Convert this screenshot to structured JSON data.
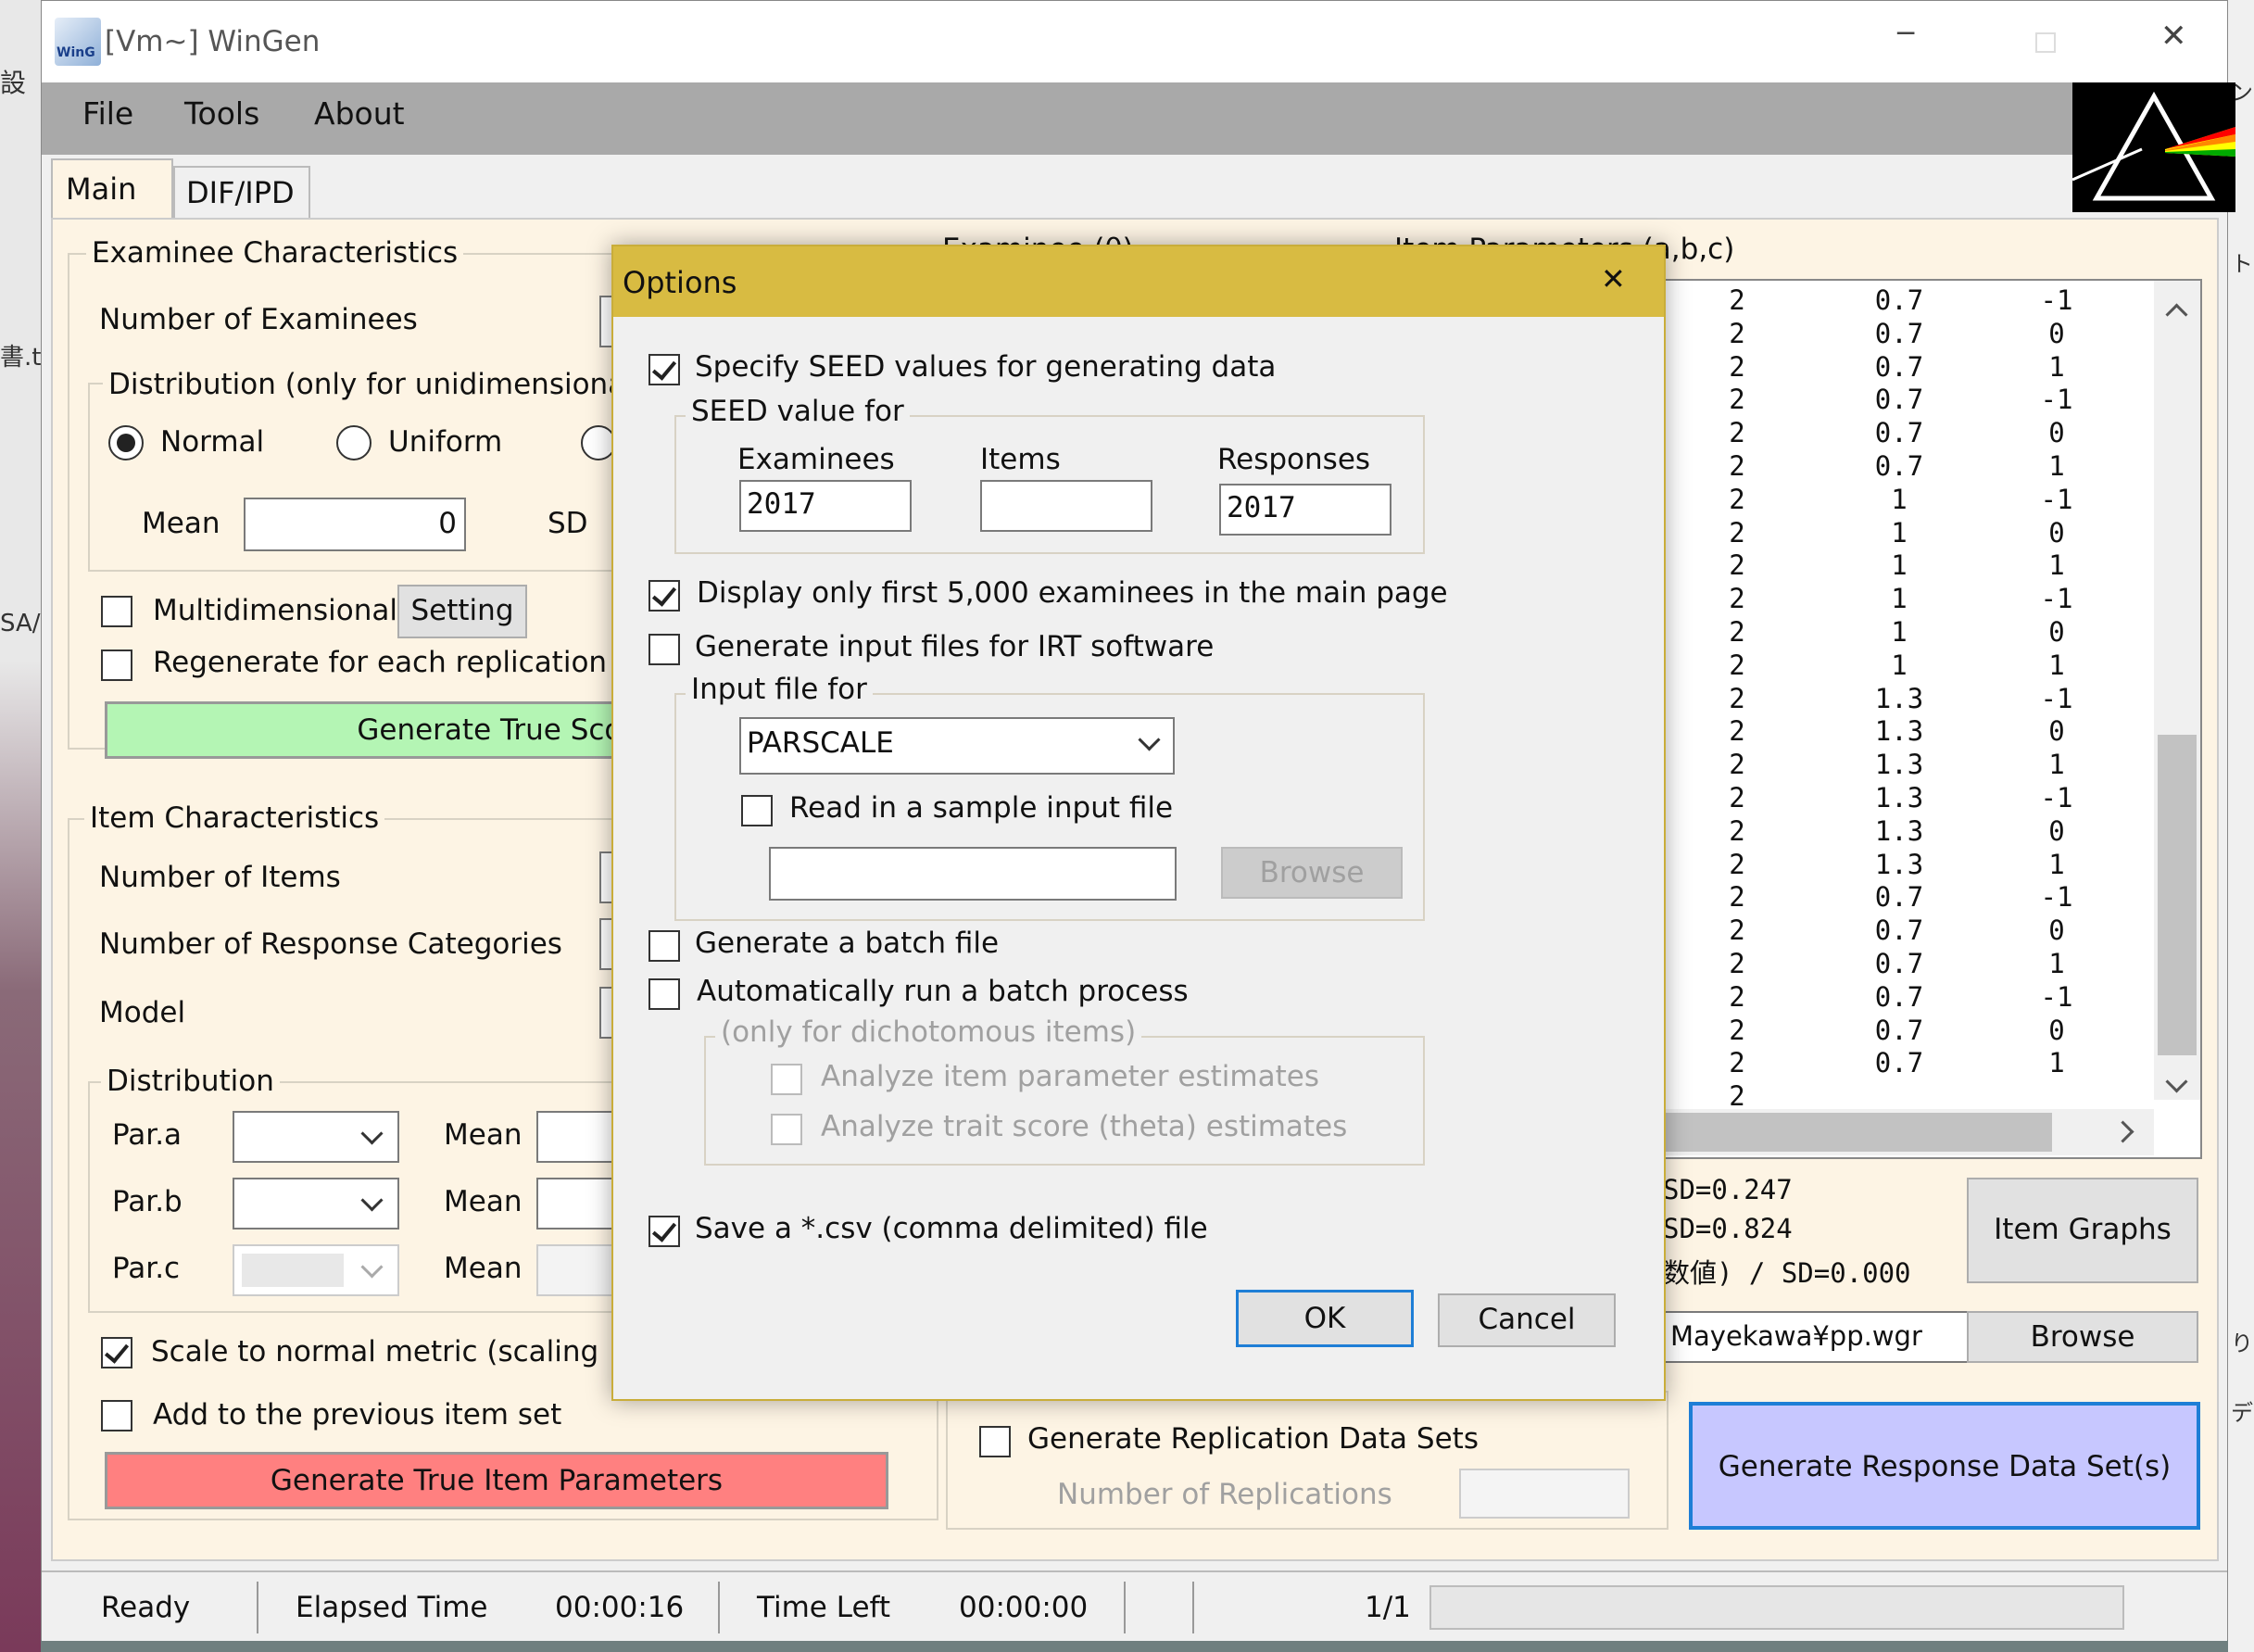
{
  "window": {
    "title": "[Vm~] WinGen",
    "logo_text": "WinG"
  },
  "menu": [
    "File",
    "Tools",
    "About"
  ],
  "tabs": [
    "Main",
    "DIF/IPD"
  ],
  "examinee": {
    "group_label": "Examinee Characteristics",
    "num_label": "Number of Examinees",
    "dist_group_label": "Distribution (only for unidimensional",
    "radio_normal": "Normal",
    "radio_uniform": "Uniform",
    "mean_label": "Mean",
    "mean_value": "0",
    "sd_label": "SD",
    "multidim_label": "Multidimensional",
    "setting_button": "Setting",
    "regen_label": "Regenerate for each replication",
    "gen_true_scores": "Generate True Scores ("
  },
  "item": {
    "group_label": "Item Characteristics",
    "num_items_label": "Number of Items",
    "num_resp_label": "Number of Response Categories",
    "model_label": "Model",
    "dist_label": "Distribution",
    "par_a": "Par.a",
    "par_b": "Par.b",
    "par_c": "Par.c",
    "mean_label": "Mean",
    "scale_label": "Scale to normal metric (scaling",
    "add_prev_label": "Add to the previous item set",
    "gen_item_params": "Generate True Item Parameters"
  },
  "right_panel": {
    "header_theta": "Examinee (θ)",
    "header_params": "Item Parameters (a,b,c)",
    "table_col1": [
      "2",
      "2",
      "2",
      "2",
      "2",
      "2",
      "2",
      "2",
      "2",
      "2",
      "2",
      "2",
      "2",
      "2",
      "2",
      "2",
      "2",
      "2",
      "2",
      "2",
      "2",
      "2",
      "2",
      "2",
      "2"
    ],
    "table_col2": [
      "0.7",
      "0.7",
      "0.7",
      "0.7",
      "0.7",
      "0.7",
      "1",
      "1",
      "1",
      "1",
      "1",
      "1",
      "1.3",
      "1.3",
      "1.3",
      "1.3",
      "1.3",
      "1.3",
      "0.7",
      "0.7",
      "0.7",
      "0.7",
      "0.7",
      "0.7"
    ],
    "table_col3": [
      "-1",
      "0",
      "1",
      "-1",
      "0",
      "1",
      "-1",
      "0",
      "1",
      "-1",
      "0",
      "1",
      "-1",
      "0",
      "1",
      "-1",
      "0",
      "1",
      "-1",
      "0",
      "1",
      "-1",
      "0",
      "1"
    ],
    "stat1": "SD=0.247",
    "stat2": "SD=0.824",
    "stat3": "数値) / SD=0.000",
    "item_graphs": "Item Graphs",
    "file_path": "Mayekawa¥pp.wgr",
    "browse": "Browse",
    "gen_rep_label": "Generate Replication Data Sets",
    "num_rep_label": "Number of Replications",
    "gen_response": "Generate Response Data Set(s)"
  },
  "status": {
    "ready": "Ready",
    "elapsed_label": "Elapsed Time",
    "elapsed_value": "00:00:16",
    "left_label": "Time Left",
    "left_value": "00:00:00",
    "page": "1/1"
  },
  "dialog": {
    "title": "Options",
    "seed_check": "Specify SEED values for generating data",
    "seed_group": "SEED value for",
    "examinees_label": "Examinees",
    "items_label": "Items",
    "responses_label": "Responses",
    "examinees_value": "2017",
    "items_value": "",
    "responses_value": "2017",
    "display_check": "Display only first 5,000 examinees in the main page",
    "gen_input_check": "Generate input files for IRT software",
    "input_group": "Input file for",
    "software_value": "PARSCALE",
    "read_sample": "Read in a sample input file",
    "browse": "Browse",
    "batch_check": "Generate a batch file",
    "auto_run_check": "Automatically run a batch process",
    "dich_group": "(only for dichotomous items)",
    "analyze_item": "Analyze item parameter estimates",
    "analyze_trait": "Analyze trait score (theta) estimates",
    "csv_check": "Save a *.csv (comma delimited) file",
    "ok": "OK",
    "cancel": "Cancel"
  },
  "desktop": {
    "left1": "設",
    "left2": "書.tx",
    "left3": "SA/",
    "right1": "ン",
    "right2": "ト.",
    "right3": "り",
    "right4": "デ"
  },
  "colors": {
    "accent_green": "#b4f5b4",
    "accent_red": "#ff8080",
    "accent_blue": "#c7c7ff",
    "dialog_title": "#d8bb42",
    "panel_bg": "#fdf4e4"
  }
}
